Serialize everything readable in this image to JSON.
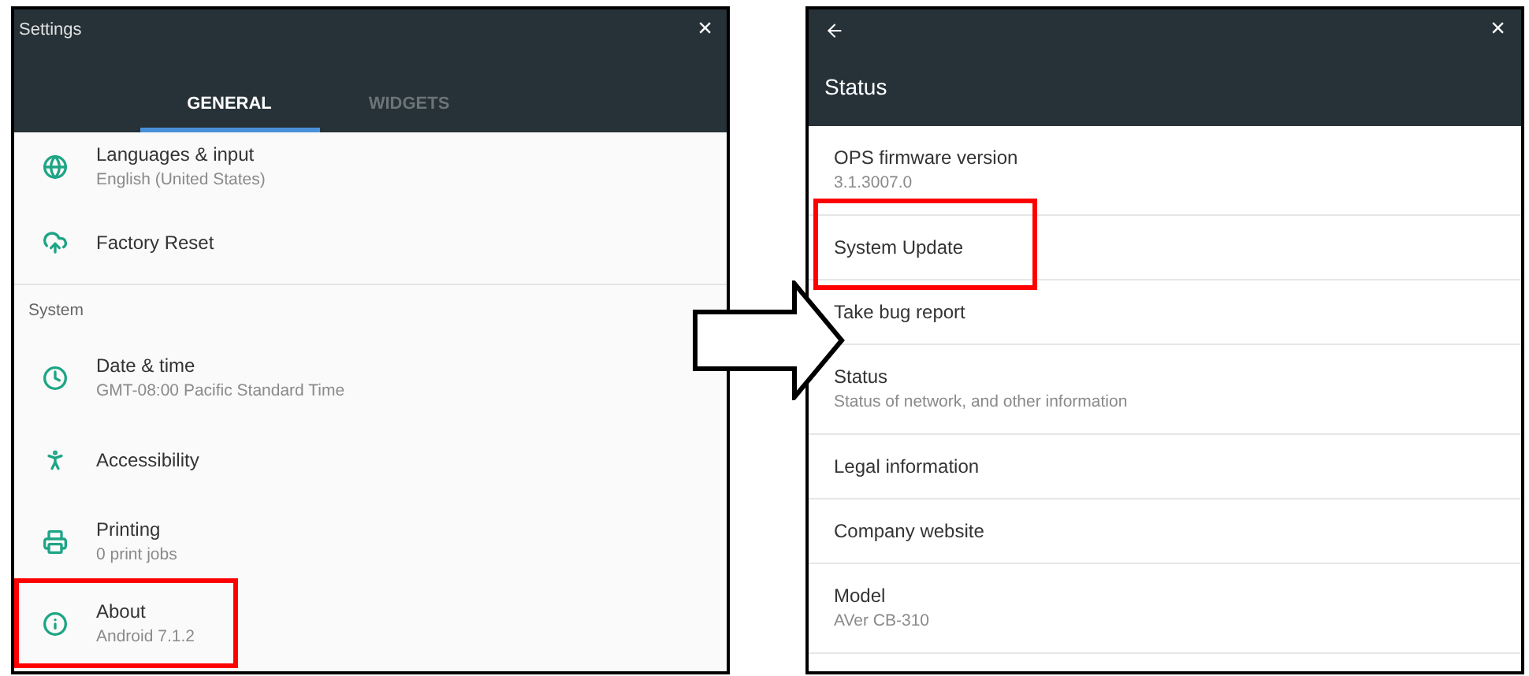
{
  "settings_window": {
    "title": "Settings",
    "close": "×",
    "tabs": [
      {
        "label": "GENERAL",
        "selected": true
      },
      {
        "label": "WIDGETS",
        "selected": false
      }
    ],
    "items": [
      {
        "kind": "item",
        "title": "Languages & input",
        "subtitle": "English (United States)",
        "highlighted": false
      },
      {
        "kind": "item",
        "title": "Factory Reset",
        "highlighted": false
      },
      {
        "kind": "header",
        "title": "System"
      },
      {
        "kind": "item",
        "title": "Date & time",
        "subtitle": "GMT-08:00 Pacific Standard Time",
        "highlighted": false
      },
      {
        "kind": "item",
        "title": "Accessibility",
        "highlighted": false
      },
      {
        "kind": "item",
        "title": "Printing",
        "subtitle": "0 print jobs",
        "highlighted": false
      },
      {
        "kind": "item",
        "title": "About",
        "subtitle": "Android 7.1.2",
        "highlighted": true
      }
    ]
  },
  "status_window": {
    "title": "Status",
    "close": "×",
    "items": [
      {
        "title": "OPS firmware version",
        "subtitle": "3.1.3007.0",
        "highlighted": false
      },
      {
        "title": "System Update",
        "highlighted": true
      },
      {
        "title": "Take bug report",
        "highlighted": false
      },
      {
        "title": "Status",
        "subtitle": "Status of network, and other information",
        "highlighted": false
      },
      {
        "title": "Legal information",
        "highlighted": false
      },
      {
        "title": "Company website",
        "highlighted": false
      },
      {
        "title": "Model",
        "subtitle": "AVer CB-310",
        "highlighted": false
      }
    ]
  }
}
